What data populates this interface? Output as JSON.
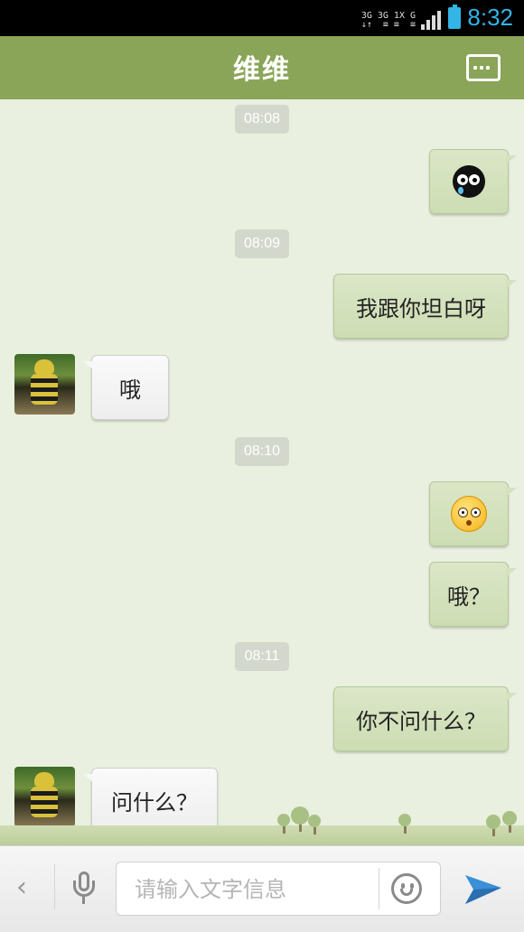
{
  "status_bar": {
    "network_1": "3G",
    "network_2": "3G 1X",
    "network_3": "G",
    "time": "8:32",
    "accent_color": "#33b5e5"
  },
  "header": {
    "title": "维维",
    "menu_icon": "more-icon",
    "color": "#8aa557"
  },
  "messages": [
    {
      "type": "timestamp",
      "text": "08:08"
    },
    {
      "type": "outgoing",
      "content": "emoji",
      "icon": "crying-black-face-icon"
    },
    {
      "type": "timestamp",
      "text": "08:09"
    },
    {
      "type": "outgoing",
      "content": "text",
      "text": "我跟你坦白呀"
    },
    {
      "type": "incoming",
      "content": "text",
      "text": "哦"
    },
    {
      "type": "timestamp",
      "text": "08:10"
    },
    {
      "type": "outgoing",
      "content": "emoji",
      "icon": "surprised-face-icon"
    },
    {
      "type": "outgoing",
      "content": "text",
      "text": "哦？"
    },
    {
      "type": "timestamp",
      "text": "08:11"
    },
    {
      "type": "outgoing",
      "content": "text",
      "text": "你不问什么？"
    },
    {
      "type": "incoming",
      "content": "text",
      "text": "问什么？"
    }
  ],
  "input_bar": {
    "back_icon": "chevron-left-icon",
    "mic_icon": "microphone-icon",
    "placeholder": "请输入文字信息",
    "value": "",
    "emoji_icon": "smiley-icon",
    "send_icon": "send-arrow-icon"
  }
}
